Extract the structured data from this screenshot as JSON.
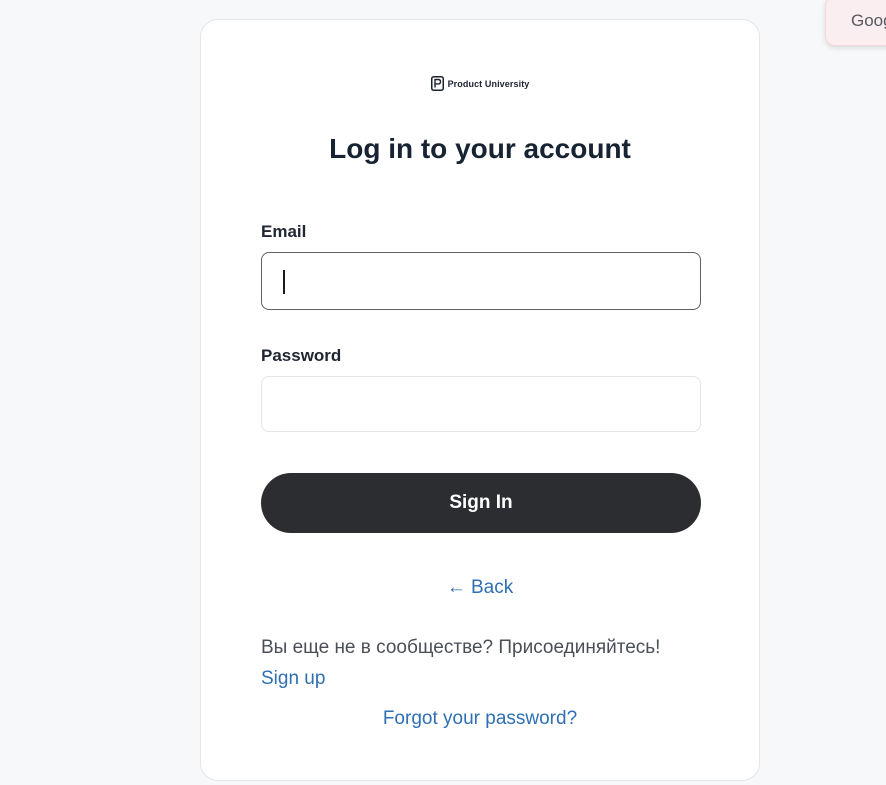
{
  "brand": {
    "name": "Product University"
  },
  "login": {
    "title": "Log in to your account",
    "email_label": "Email",
    "email_value": "",
    "password_label": "Password",
    "password_value": "",
    "signin_label": "Sign In",
    "back_label": "← Back",
    "community_text": "Вы еще не в сообществе? Присоединяйтесь!",
    "signup_label": "Sign up",
    "forgot_label": "Forgot your password?"
  },
  "overlay": {
    "google_label": "Google"
  },
  "colors": {
    "button": "#2b2d31",
    "link": "#2f6fb3",
    "title": "#172233"
  },
  "icons": {
    "brand_logo": "product-university-logo-icon"
  }
}
